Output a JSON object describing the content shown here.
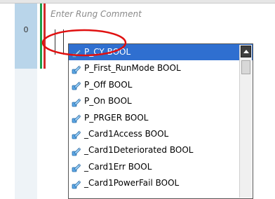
{
  "rung": {
    "number": "0",
    "comment_placeholder": "Enter Rung Comment"
  },
  "autocomplete": {
    "items": [
      {
        "name": "P_CY",
        "type": "BOOL",
        "selected": true
      },
      {
        "name": "P_First_RunMode",
        "type": "BOOL",
        "selected": false
      },
      {
        "name": "P_Off",
        "type": "BOOL",
        "selected": false
      },
      {
        "name": "P_On",
        "type": "BOOL",
        "selected": false
      },
      {
        "name": "P_PRGER",
        "type": "BOOL",
        "selected": false
      },
      {
        "name": "_Card1Access",
        "type": "BOOL",
        "selected": false
      },
      {
        "name": "_Card1Deteriorated",
        "type": "BOOL",
        "selected": false
      },
      {
        "name": "_Card1Err",
        "type": "BOOL",
        "selected": false
      },
      {
        "name": "_Card1PowerFail",
        "type": "BOOL",
        "selected": false
      }
    ],
    "selected_color": "#2f6fd0",
    "scroll_position": 0.0
  },
  "colors": {
    "rail_green": "#1e9e4a",
    "rail_red": "#d42a2a",
    "gutter": "#b9d5ea",
    "annotation_circle": "#e01010"
  },
  "icons": {
    "variable_item": "variable-icon"
  }
}
